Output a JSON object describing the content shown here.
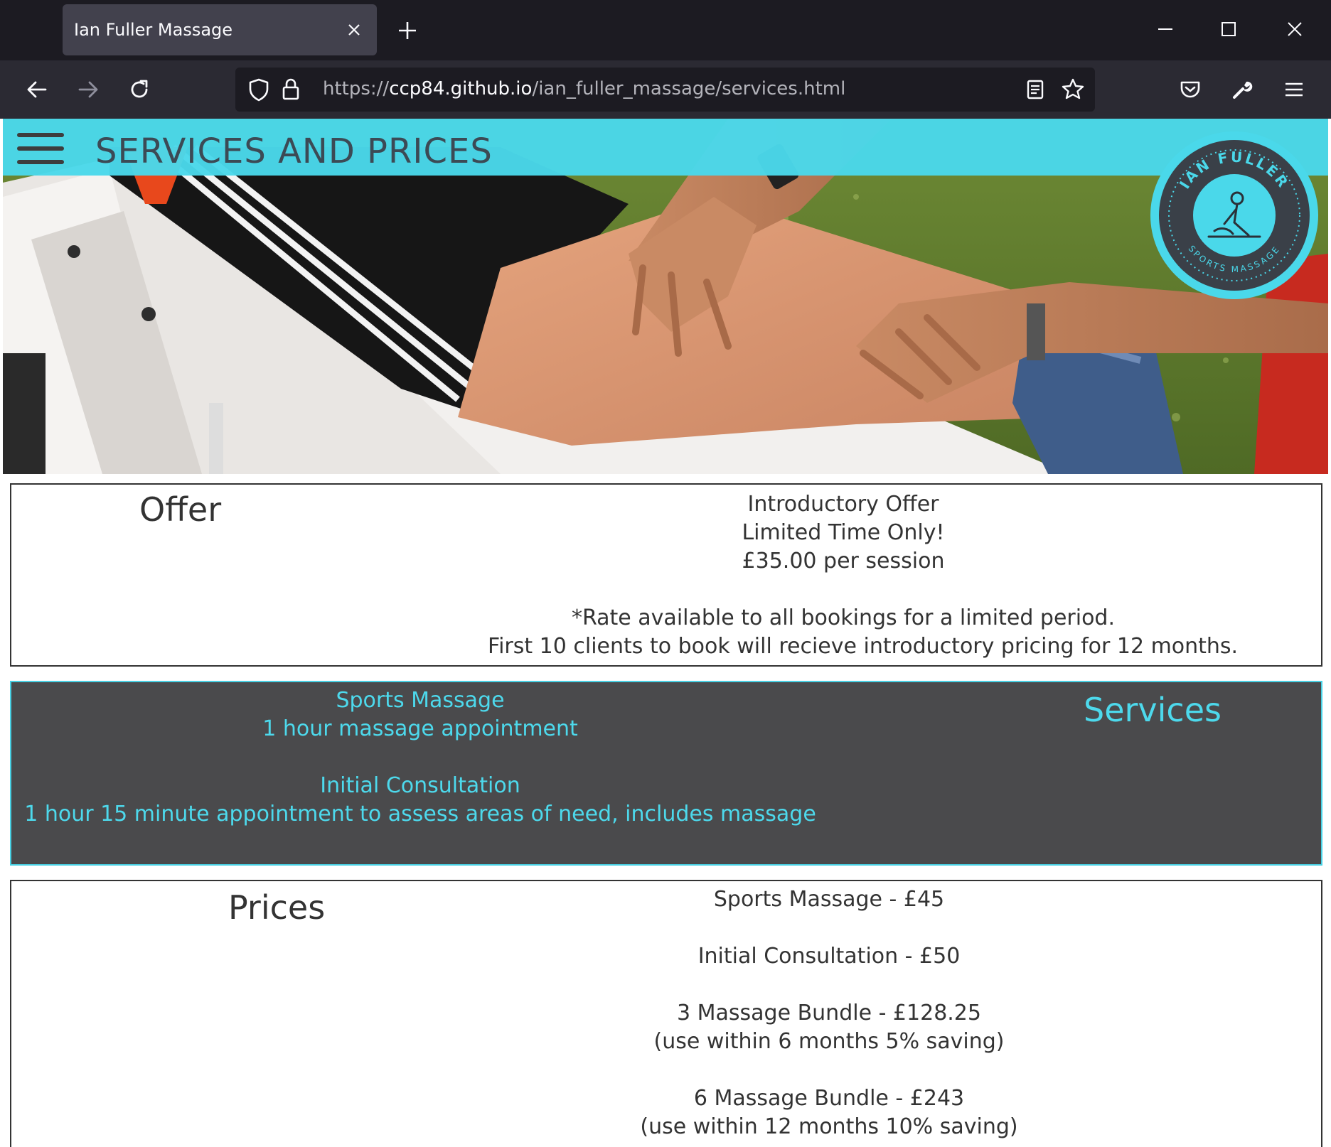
{
  "browser": {
    "tab_title": "Ian Fuller Massage",
    "url_prefix": "https://",
    "url_host": "ccp84.github.io",
    "url_path": "/ian_fuller_massage/services.html"
  },
  "header": {
    "title": "SERVICES AND PRICES"
  },
  "logo": {
    "top_text": "IAN FULLER",
    "bottom_text": "SPORTS MASSAGE"
  },
  "offer": {
    "heading": "Offer",
    "lines": [
      "Introductory Offer",
      "Limited Time Only!",
      "£35.00 per session"
    ],
    "notes": [
      "*Rate available to all bookings for a limited period.",
      "First 10 clients to book will recieve introductory pricing for 12 months."
    ]
  },
  "services": {
    "heading": "Services",
    "items": [
      {
        "name": "Sports Massage",
        "desc": "1 hour massage appointment"
      },
      {
        "name": "Initial Consultation",
        "desc": "1 hour 15 minute appointment to assess areas of need, includes massage"
      }
    ]
  },
  "prices": {
    "heading": "Prices",
    "items": [
      {
        "line": "Sports Massage - £45",
        "note": ""
      },
      {
        "line": "Initial Consultation - £50",
        "note": ""
      },
      {
        "line": "3 Massage Bundle - £128.25",
        "note": "(use within 6 months 5% saving)"
      },
      {
        "line": "6 Massage Bundle - £243",
        "note": "(use within 12 months 10% saving)"
      }
    ]
  },
  "colors": {
    "accent": "#4ad8ea",
    "services_bg": "#4a4a4c",
    "chrome_dark": "#1c1b22"
  }
}
